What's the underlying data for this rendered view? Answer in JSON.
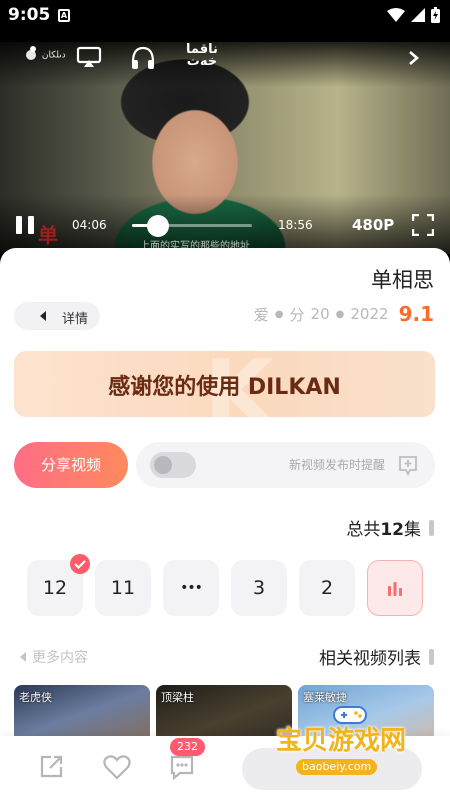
{
  "status_bar": {
    "time": "9:05",
    "badge": "A"
  },
  "video": {
    "watermark": "دىلكان",
    "logo": "ناقما\nخەت",
    "current_time": "04:06",
    "duration": "18:56",
    "progress": 0.22,
    "quality": "480P",
    "subtitle": "上面的实写的那些的地址"
  },
  "detail": {
    "title": "单相思",
    "details_label": "详情",
    "genre": "爱",
    "category": "分",
    "episodes_meta": "20",
    "year": "2022",
    "score": "9.1"
  },
  "banner": {
    "text": "感谢您的使用 DILKAN"
  },
  "actions": {
    "share_label": "分享视频",
    "remind_label": "新视频发布时提醒",
    "remind_on": false
  },
  "episodes": {
    "header_prefix": "总共",
    "count": "12",
    "header_suffix": "集",
    "items": [
      "12",
      "11",
      "•••",
      "3",
      "2"
    ]
  },
  "related": {
    "title": "相关视频列表",
    "more_label": "更多内容",
    "items": [
      {
        "label": "老虎侠"
      },
      {
        "label": "顶梁柱"
      },
      {
        "label": "塞莱敏捷"
      }
    ]
  },
  "bottom_bar": {
    "comment_count": "232"
  },
  "site_watermark": {
    "name": "宝贝游戏网",
    "url": "baobeiy.com"
  },
  "colors": {
    "accent": "#ff6d86",
    "score": "#ff6a2b",
    "banner_text": "#6a2a14"
  }
}
